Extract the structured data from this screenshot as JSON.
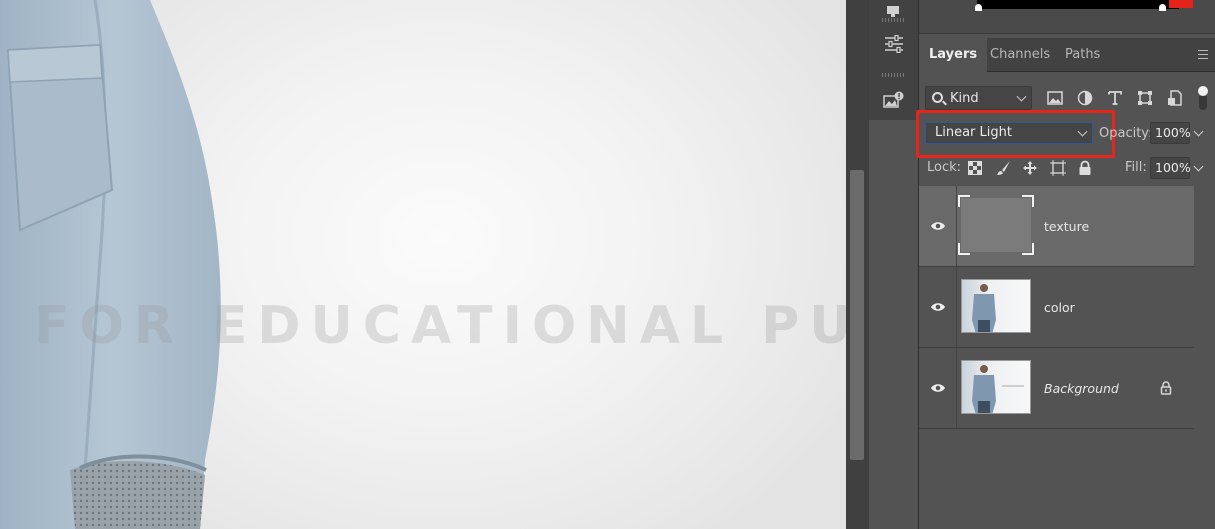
{
  "canvas": {
    "watermark": "FOR EDUCATIONAL PURPOSES"
  },
  "panel_tabs": [
    {
      "label": "Layers",
      "active": true
    },
    {
      "label": "Channels",
      "active": false
    },
    {
      "label": "Paths",
      "active": false
    }
  ],
  "filter": {
    "kind_label": "Kind",
    "icons": [
      "image-filter-icon",
      "adjustment-filter-icon",
      "type-filter-icon",
      "shape-filter-icon",
      "smart-object-filter-icon"
    ]
  },
  "blend": {
    "mode": "Linear Light",
    "opacity_label": "Opacity:",
    "opacity_value": "100%"
  },
  "lock": {
    "label": "Lock:",
    "icons": [
      "lock-transparent-pixels-icon",
      "lock-image-pixels-icon",
      "lock-position-icon",
      "artboard-nesting-icon",
      "lock-all-icon"
    ],
    "fill_label": "Fill:",
    "fill_value": "100%"
  },
  "layers": [
    {
      "name": "texture",
      "selected": true,
      "italic": false,
      "locked": false,
      "thumb": "texture"
    },
    {
      "name": "color",
      "selected": false,
      "italic": false,
      "locked": false,
      "thumb": "photo"
    },
    {
      "name": "Background",
      "selected": false,
      "italic": true,
      "locked": true,
      "thumb": "photo"
    }
  ],
  "colors": {
    "highlight": "#e8251b",
    "panel_bg": "#535353",
    "selected_row": "#696969"
  }
}
